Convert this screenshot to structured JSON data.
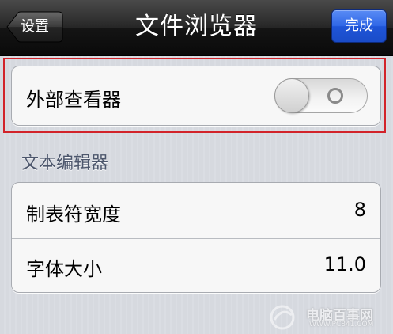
{
  "navbar": {
    "title": "文件浏览器",
    "back_label": "设置",
    "done_label": "完成"
  },
  "external_viewer": {
    "label": "外部查看器",
    "toggle_on": false
  },
  "text_editor": {
    "header": "文本编辑器",
    "rows": [
      {
        "label": "制表符宽度",
        "value": "8"
      },
      {
        "label": "字体大小",
        "value": "11.0"
      }
    ]
  },
  "watermark": {
    "name": "电脑百事网",
    "url": "WWW.PC841.COM"
  },
  "colors": {
    "highlight": "#d2232a",
    "done_button": "#2e66e6"
  }
}
